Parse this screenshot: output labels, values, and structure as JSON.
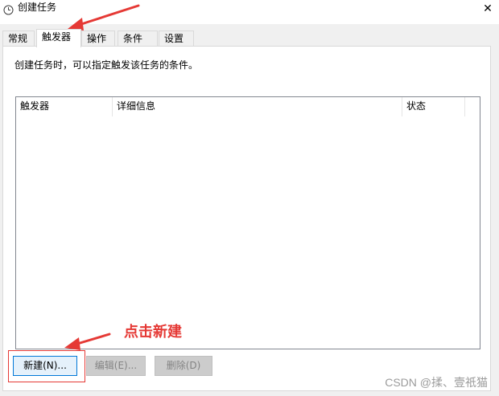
{
  "window": {
    "title": "创建任务",
    "close_glyph": "✕"
  },
  "tabs": [
    {
      "label": "常规",
      "active": false
    },
    {
      "label": "触发器",
      "active": true
    },
    {
      "label": "操作",
      "active": false
    },
    {
      "label": "条件",
      "active": false
    },
    {
      "label": "设置",
      "active": false
    }
  ],
  "panel": {
    "description": "创建任务时，可以指定触发该任务的条件。",
    "columns": [
      "触发器",
      "详细信息",
      "状态"
    ],
    "rows": []
  },
  "buttons": {
    "new_label": "新建(N)...",
    "edit_label": "编辑(E)...",
    "delete_label": "删除(D)"
  },
  "annotation": {
    "text": "点击新建",
    "color": "#e53935"
  },
  "watermark": "CSDN @揉、壹祇猫"
}
